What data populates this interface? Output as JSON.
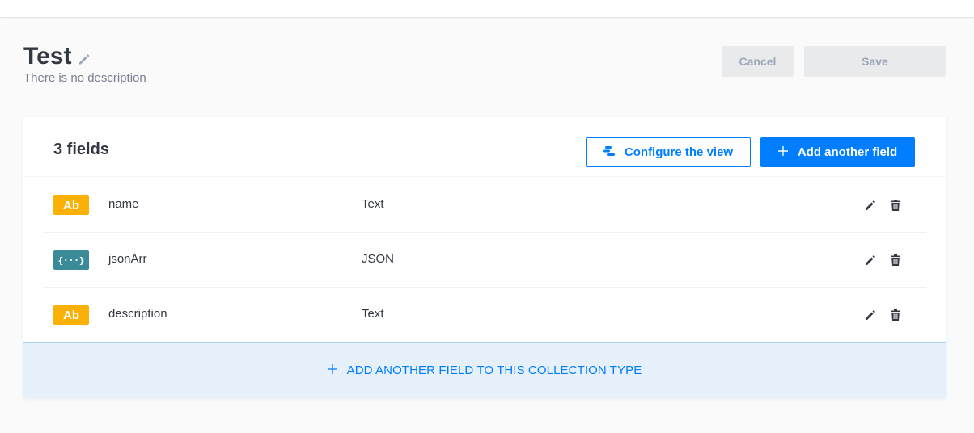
{
  "header": {
    "title": "Test",
    "description": "There is no description",
    "cancel_label": "Cancel",
    "save_label": "Save"
  },
  "card": {
    "fields_count": "3 fields",
    "configure_label": "Configure the view",
    "add_field_label": "Add another field",
    "footer_label": "ADD ANOTHER FIELD TO THIS COLLECTION TYPE"
  },
  "fields": [
    {
      "badge": "Ab",
      "badge_kind": "text",
      "name": "name",
      "type": "Text"
    },
    {
      "badge": "{···}",
      "badge_kind": "json",
      "name": "jsonArr",
      "type": "JSON"
    },
    {
      "badge": "Ab",
      "badge_kind": "text",
      "name": "description",
      "type": "Text"
    }
  ],
  "colors": {
    "primary": "#007eff",
    "text_badge": "#fab005",
    "json_badge": "#3b8a97",
    "disabled_bg": "#e9eaeb"
  },
  "icons": {
    "title_edit": "pencil-icon",
    "configure": "list-settings-icon",
    "add": "plus-icon",
    "row_edit": "pencil-icon",
    "row_delete": "trash-icon"
  }
}
